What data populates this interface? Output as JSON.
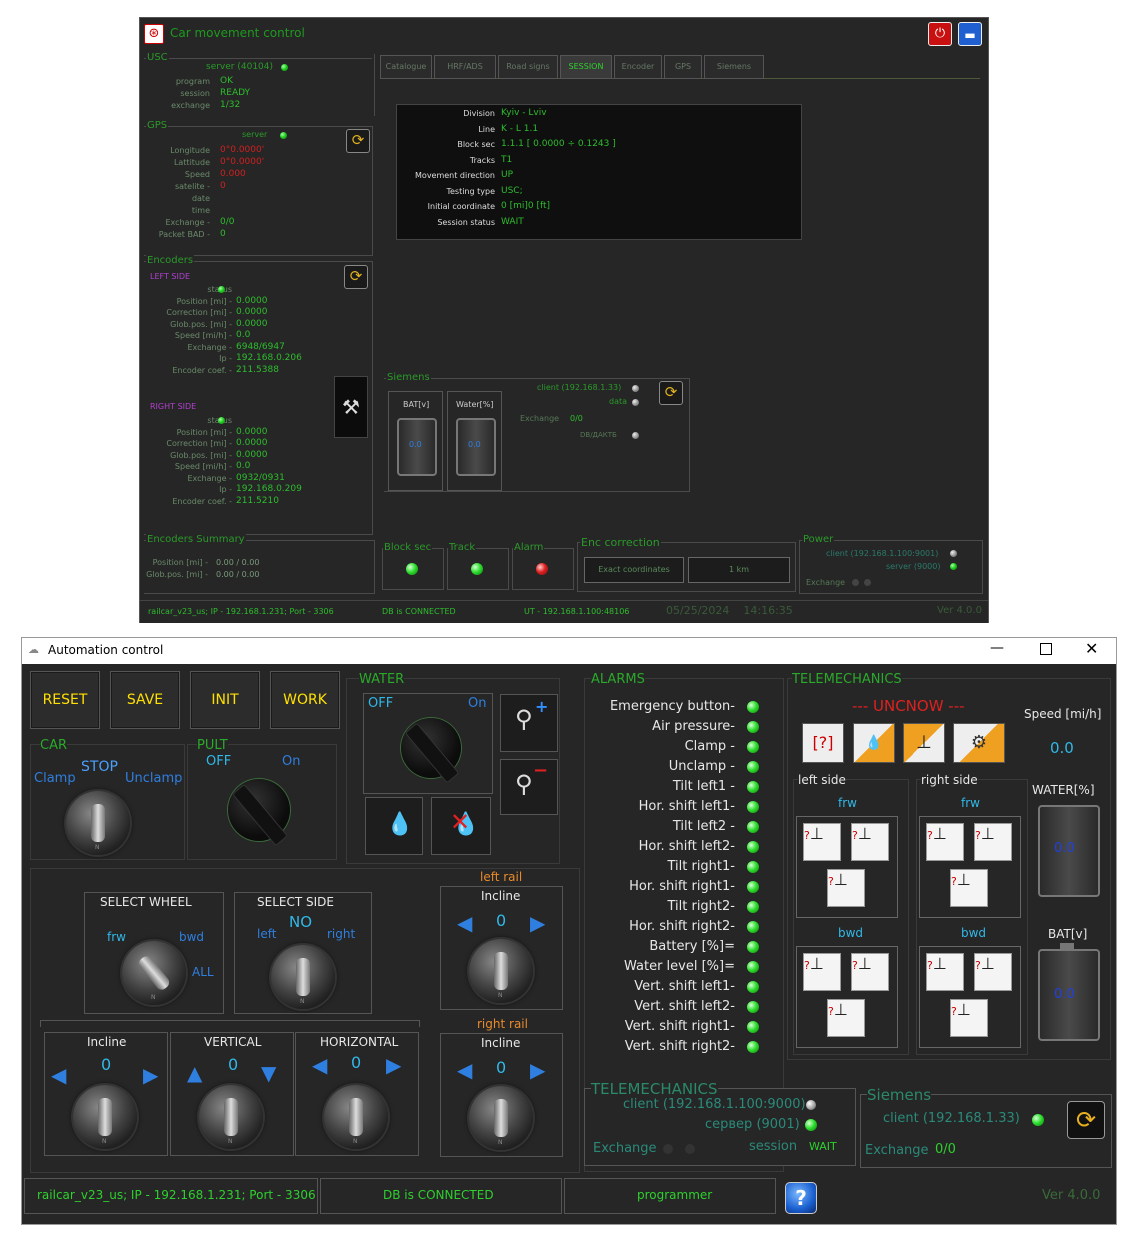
{
  "w1": {
    "title": "Car movement control",
    "usc": {
      "legend": "USC",
      "server": "server (40104)",
      "program_label": "program",
      "program_value": "OK",
      "session_label": "session",
      "session_value": "READY",
      "exchange_label": "exchange",
      "exchange_value": "1/32"
    },
    "gps": {
      "legend": "GPS",
      "server": "server",
      "rows": [
        {
          "label": "Longitude",
          "value": "0°0.0000'",
          "red": true
        },
        {
          "label": "Lattitude",
          "value": "0°0.0000'",
          "red": true
        },
        {
          "label": "Speed",
          "value": "0.000",
          "red": true
        },
        {
          "label": "satelite -",
          "value": "0",
          "red": true
        },
        {
          "label": "date",
          "value": "",
          "red": false
        },
        {
          "label": "time",
          "value": "",
          "red": false
        },
        {
          "label": "Exchange -",
          "value": "0/0",
          "red": false
        },
        {
          "label": "Packet BAD -",
          "value": "0",
          "red": false
        }
      ]
    },
    "encoders": {
      "legend": "Encoders",
      "left": {
        "title": "LEFT SIDE",
        "rows": [
          {
            "label": "status",
            "value": ""
          },
          {
            "label": "Position [mi] -",
            "value": "0.0000"
          },
          {
            "label": "Correction [mi] -",
            "value": "0.0000"
          },
          {
            "label": "Glob.pos. [mi] -",
            "value": "0.0000"
          },
          {
            "label": "Speed [mi/h] -",
            "value": "0.0"
          },
          {
            "label": "Exchange -",
            "value": "6948/6947"
          },
          {
            "label": "Ip -",
            "value": "192.168.0.206"
          },
          {
            "label": "Encoder coef. -",
            "value": "211.5388"
          }
        ]
      },
      "right": {
        "title": "RIGHT SIDE",
        "rows": [
          {
            "label": "status",
            "value": ""
          },
          {
            "label": "Position [mi] -",
            "value": "0.0000"
          },
          {
            "label": "Correction [mi] -",
            "value": "0.0000"
          },
          {
            "label": "Glob.pos. [mi] -",
            "value": "0.0000"
          },
          {
            "label": "Speed [mi/h] -",
            "value": "0.0"
          },
          {
            "label": "Exchange -",
            "value": "0932/0931"
          },
          {
            "label": "Ip -",
            "value": "192.168.0.209"
          },
          {
            "label": "Encoder coef. -",
            "value": "211.5210"
          }
        ]
      }
    },
    "summary": {
      "legend": "Encoders Summary",
      "pos_label": "Position [mi] -",
      "pos_value": "0.00 / 0.00",
      "glob_label": "Glob.pos. [mi] -",
      "glob_value": "0.00 / 0.00"
    },
    "tabs": [
      "Catalogue",
      "HRF/ADS",
      "Road signs",
      "SESSION",
      "Encoder",
      "GPS",
      "Siemens"
    ],
    "session": [
      {
        "label": "Division",
        "value": "Kyiv - Lviv"
      },
      {
        "label": "Line",
        "value": "K - L 1.1"
      },
      {
        "label": "Block sec",
        "value": "1.1.1 [ 0.0000 ÷ 0.1243 ]"
      },
      {
        "label": "Tracks",
        "value": "T1"
      },
      {
        "label": "Movement direction",
        "value": "UP"
      },
      {
        "label": "Testing type",
        "value": "USC;"
      },
      {
        "label": "Initial coordinate",
        "value": "0 [mi]0 [ft]"
      },
      {
        "label": "Session status",
        "value": "WAIT"
      }
    ],
    "siemens": {
      "legend": "Siemens",
      "bat_label": "BAT[v]",
      "bat_value": "0.0",
      "water_label": "Water[%]",
      "water_value": "0.0",
      "client": "client (192.168.1.33)",
      "data": "data",
      "exchange_label": "Exchange",
      "exchange_value": "0/0",
      "db": "DB/ДАКТБ"
    },
    "indicators": {
      "block": "Block sec",
      "track": "Track",
      "alarm": "Alarm"
    },
    "enc_corr": {
      "legend": "Enc correction",
      "exact": "Exact coordinates",
      "km": "1 km"
    },
    "power": {
      "legend": "Power",
      "client": "client (192.168.1.100:9001)",
      "server": "server (9000)",
      "exchange": "Exchange"
    },
    "status": {
      "db_conn": "railcar_v23_us; IP - 192.168.1.231; Port - 3306",
      "db": "DB is CONNECTED",
      "ut": "UT - 192.168.1.100:48106",
      "datetime": "05/25/2024    14:16:35",
      "ver": "Ver 4.0.0"
    }
  },
  "w2": {
    "title": "Automation control",
    "buttons": [
      "RESET",
      "SAVE",
      "INIT",
      "WORK"
    ],
    "car": {
      "legend": "CAR",
      "stop": "STOP",
      "clamp": "Clamp",
      "unclamp": "Unclamp"
    },
    "pult": {
      "legend": "PULT",
      "off": "OFF",
      "on": "On"
    },
    "water": {
      "legend": "WATER",
      "off": "OFF",
      "on": "On"
    },
    "select_wheel": {
      "title": "SELECT WHEEL",
      "frw": "frw",
      "bwd": "bwd",
      "all": "ALL"
    },
    "select_side": {
      "title": "SELECT SIDE",
      "value": "NO",
      "left": "left",
      "right": "right"
    },
    "left_rail": {
      "title": "left rail",
      "sub": "Incline",
      "value": "0"
    },
    "right_rail": {
      "title": "right rail",
      "sub": "Incline",
      "value": "0"
    },
    "incline": {
      "title": "Incline",
      "value": "0"
    },
    "vertical": {
      "title": "VERTICAL",
      "value": "0"
    },
    "horizontal": {
      "title": "HORIZONTAL",
      "value": "0"
    },
    "alarms": {
      "legend": "ALARMS",
      "items": [
        "Emergency button-",
        "Air pressure-",
        "Clamp -",
        "Unclamp -",
        "Tilt left1 -",
        "Hor. shift left1-",
        "Tilt left2 -",
        "Hor. shift left2-",
        "Tilt right1-",
        "Hor. shift right1-",
        "Tilt right2-",
        "Hor. shift right2-",
        "Battery [%]=",
        "Water level [%]=",
        "Vert. shift left1-",
        "Vert. shift left2-",
        "Vert. shift right1-",
        "Vert. shift right2-"
      ]
    },
    "telemechanics": {
      "legend": "TELEMECHANICS",
      "status": "--- UNCNOW ---",
      "speed_label": "Speed [mi/h]",
      "speed_value": "0.0",
      "left_side": "left side",
      "right_side": "right side",
      "frw": "frw",
      "bwd": "bwd",
      "water_label": "WATER[%]",
      "water_value": "0.0",
      "bat_label": "BAT[v]",
      "bat_value": "0.0"
    },
    "tele2": {
      "legend": "TELEMECHANICS",
      "client": "client (192.168.1.100:9000)",
      "server": "сервер (9001)",
      "exchange": "Exchange",
      "session": "session",
      "session_value": "WAIT"
    },
    "siemens": {
      "legend": "Siemens",
      "client": "client (192.168.1.33)",
      "exchange": "Exchange",
      "exchange_value": "0/0"
    },
    "status": {
      "db_conn": "railcar_v23_us; IP - 192.168.1.231; Port - 3306",
      "db": "DB is CONNECTED",
      "user": "programmer",
      "ver": "Ver 4.0.0"
    }
  }
}
